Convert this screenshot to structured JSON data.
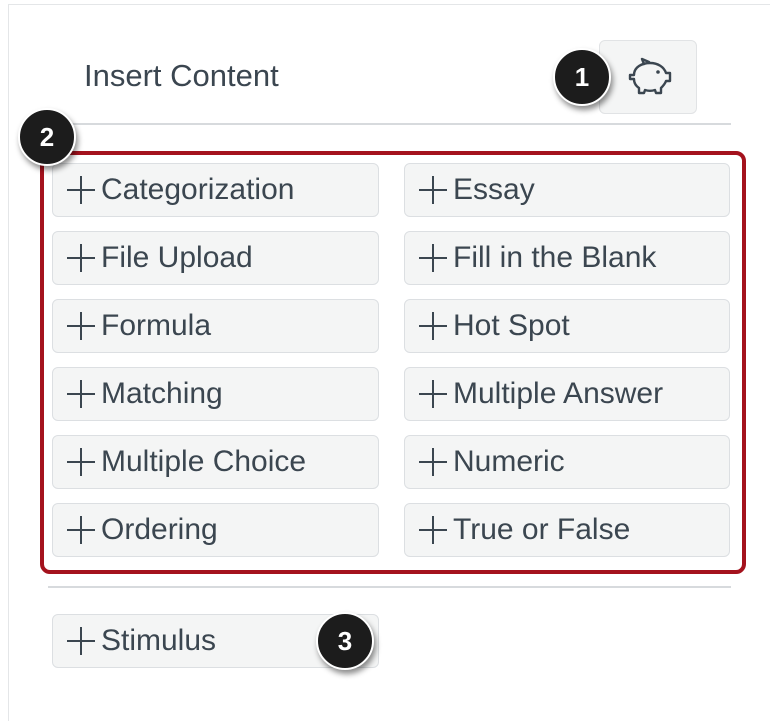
{
  "header": {
    "title": "Insert Content",
    "bank_icon": "piggy-bank-icon"
  },
  "question_types": [
    [
      "Categorization",
      "Essay"
    ],
    [
      "File Upload",
      "Fill in the Blank"
    ],
    [
      "Formula",
      "Hot Spot"
    ],
    [
      "Matching",
      "Multiple Answer"
    ],
    [
      "Multiple Choice",
      "Numeric"
    ],
    [
      "Ordering",
      "True or False"
    ]
  ],
  "stimulus": {
    "label": "Stimulus"
  },
  "callouts": {
    "one": "1",
    "two": "2",
    "three": "3"
  },
  "colors": {
    "highlight": "#a4121d",
    "text": "#3b4650",
    "button_bg": "#f4f5f5"
  }
}
